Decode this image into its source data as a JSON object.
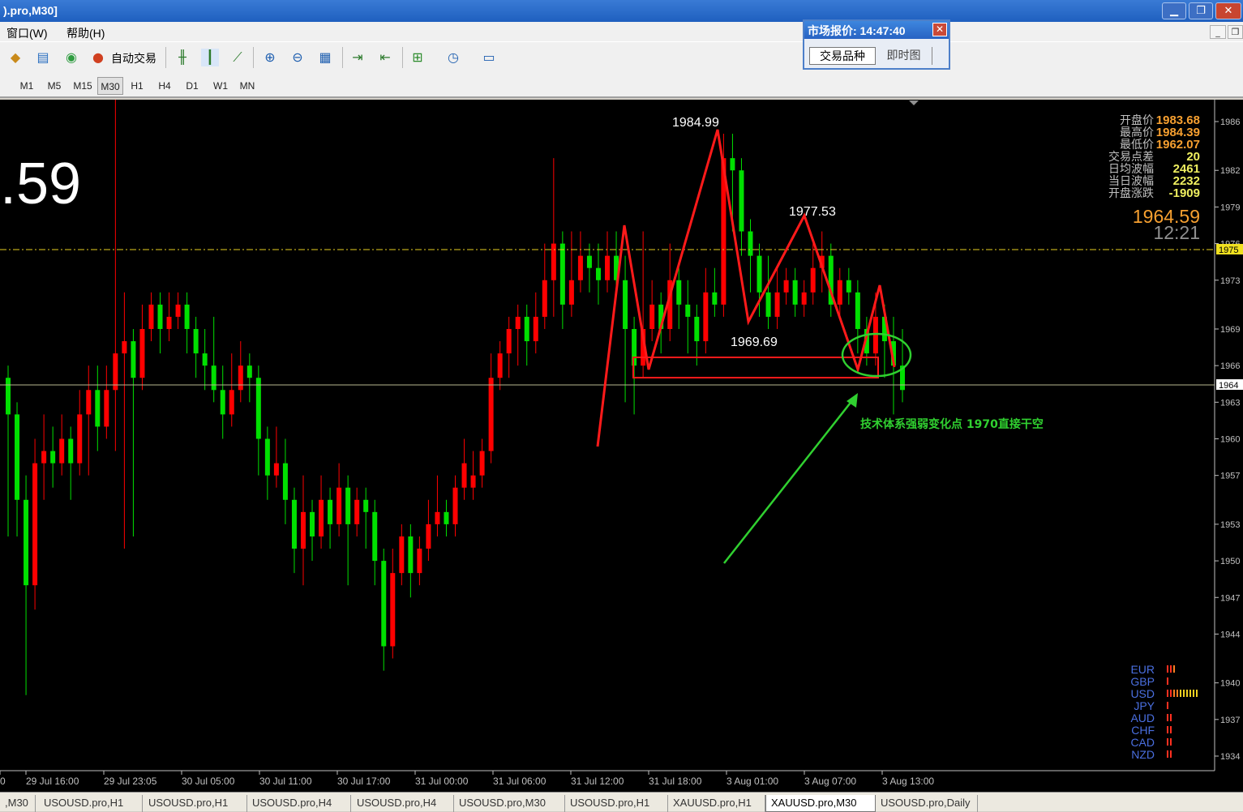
{
  "window": {
    "title": ").pro,M30]"
  },
  "menu": [
    "窗口(W)",
    "帮助(H)"
  ],
  "toolbar": {
    "auto_trade_label": "自动交易"
  },
  "timeframes": [
    "M1",
    "M5",
    "M15",
    "M30",
    "H1",
    "H4",
    "D1",
    "W1",
    "MN"
  ],
  "active_timeframe": "M30",
  "market_watch": {
    "title": "市场报价: 14:47:40",
    "tabs": [
      "交易品种",
      "即时图"
    ]
  },
  "chart": {
    "big_price_partial": ".59",
    "info_labels": [
      "开盘价",
      "最高价",
      "最低价",
      "交易点差",
      "日均波幅",
      "当日波幅",
      "开盘涨跌"
    ],
    "info_values": [
      "1983.68",
      "1984.39",
      "1962.07",
      "20",
      "2461",
      "2232",
      "-1909"
    ],
    "current_price": "1964.59",
    "countdown": "12:21",
    "price_axis": [
      "1986",
      "1982",
      "1979",
      "1976",
      "1973",
      "1969",
      "1966",
      "1963",
      "1960",
      "1957",
      "1953",
      "1950",
      "1947",
      "1944",
      "1940",
      "1937",
      "1934"
    ],
    "price_marker_1975": "1975",
    "price_marker_bid": "1964",
    "time_axis": [
      "0",
      "29 Jul 16:00",
      "29 Jul 23:05",
      "30 Jul 05:00",
      "30 Jul 11:00",
      "30 Jul 17:00",
      "31 Jul 00:00",
      "31 Jul 06:00",
      "31 Jul 12:00",
      "31 Jul 18:00",
      "3 Aug 01:00",
      "3 Aug 07:00",
      "3 Aug 13:00"
    ],
    "annotations": {
      "high": "1984.99",
      "second_high": "1977.53",
      "low": "1969.69",
      "comment": "技术体系强弱变化点 1970直接干空"
    },
    "currency_strength": [
      {
        "code": "EUR",
        "bars": 3
      },
      {
        "code": "GBP",
        "bars": 1
      },
      {
        "code": "USD",
        "bars": 10
      },
      {
        "code": "JPY",
        "bars": 1
      },
      {
        "code": "AUD",
        "bars": 2
      },
      {
        "code": "CHF",
        "bars": 2
      },
      {
        "code": "CAD",
        "bars": 2
      },
      {
        "code": "NZD",
        "bars": 2
      }
    ],
    "candles": [
      [
        1965,
        1962,
        1966,
        1952
      ],
      [
        1962,
        1955,
        1963,
        1952
      ],
      [
        1955,
        1948,
        1957,
        1939
      ],
      [
        1948,
        1958,
        1960,
        1946
      ],
      [
        1958,
        1959,
        1962,
        1955
      ],
      [
        1959,
        1958,
        1961,
        1956
      ],
      [
        1958,
        1960,
        1962,
        1957
      ],
      [
        1960,
        1958,
        1961,
        1955
      ],
      [
        1958,
        1962,
        1964,
        1957
      ],
      [
        1962,
        1964,
        1966,
        1957
      ],
      [
        1964,
        1961,
        1966,
        1959
      ],
      [
        1961,
        1964,
        1966,
        1960
      ],
      [
        1964,
        1967,
        1989,
        1959
      ],
      [
        1967,
        1968,
        1972,
        1951
      ],
      [
        1968,
        1965,
        1969,
        1952
      ],
      [
        1965,
        1969,
        1971,
        1964
      ],
      [
        1969,
        1971,
        1972,
        1968
      ],
      [
        1971,
        1969,
        1972,
        1967
      ],
      [
        1969,
        1970,
        1972,
        1968
      ],
      [
        1970,
        1971,
        1972,
        1969
      ],
      [
        1971,
        1969,
        1972,
        1967
      ],
      [
        1969,
        1967,
        1970,
        1965
      ],
      [
        1967,
        1966,
        1969,
        1964
      ],
      [
        1966,
        1964,
        1970,
        1963
      ],
      [
        1964,
        1962,
        1966,
        1960
      ],
      [
        1962,
        1964,
        1967,
        1961
      ],
      [
        1964,
        1966,
        1968,
        1963
      ],
      [
        1966,
        1965,
        1967,
        1963
      ],
      [
        1965,
        1960,
        1966,
        1957
      ],
      [
        1960,
        1957,
        1961,
        1955
      ],
      [
        1957,
        1958,
        1961,
        1956
      ],
      [
        1958,
        1955,
        1960,
        1953
      ],
      [
        1955,
        1951,
        1956,
        1949
      ],
      [
        1951,
        1954,
        1957,
        1948
      ],
      [
        1954,
        1952,
        1955,
        1950
      ],
      [
        1952,
        1955,
        1957,
        1951
      ],
      [
        1955,
        1953,
        1956,
        1951
      ],
      [
        1953,
        1956,
        1958,
        1952
      ],
      [
        1956,
        1953,
        1957,
        1948
      ],
      [
        1953,
        1955,
        1956,
        1952
      ],
      [
        1955,
        1954,
        1956,
        1951
      ],
      [
        1954,
        1950,
        1955,
        1948
      ],
      [
        1950,
        1943,
        1951,
        1941
      ],
      [
        1943,
        1949,
        1951,
        1942
      ],
      [
        1949,
        1952,
        1953,
        1948
      ],
      [
        1952,
        1949,
        1953,
        1947
      ],
      [
        1949,
        1951,
        1952,
        1948
      ],
      [
        1951,
        1953,
        1955,
        1950
      ],
      [
        1953,
        1954,
        1957,
        1952
      ],
      [
        1954,
        1953,
        1955,
        1952
      ],
      [
        1953,
        1956,
        1957,
        1952
      ],
      [
        1956,
        1958,
        1960,
        1955
      ],
      [
        1956,
        1957,
        1959,
        1955
      ],
      [
        1957,
        1959,
        1960,
        1956
      ],
      [
        1959,
        1965,
        1967,
        1958
      ],
      [
        1965,
        1967,
        1968,
        1964
      ],
      [
        1967,
        1969,
        1970,
        1965
      ],
      [
        1969,
        1970,
        1971,
        1966
      ],
      [
        1970,
        1968,
        1971,
        1966
      ],
      [
        1968,
        1970,
        1972,
        1967
      ],
      [
        1970,
        1973,
        1976,
        1969
      ],
      [
        1973,
        1976,
        1983,
        1970
      ],
      [
        1976,
        1971,
        1977,
        1969
      ],
      [
        1971,
        1973,
        1977,
        1970
      ],
      [
        1973,
        1975,
        1977,
        1972
      ],
      [
        1975,
        1974,
        1976,
        1972
      ],
      [
        1974,
        1973,
        1976,
        1971
      ],
      [
        1973,
        1975,
        1977,
        1972
      ],
      [
        1975,
        1973,
        1977,
        1972
      ],
      [
        1973,
        1969,
        1975,
        1963
      ],
      [
        1969,
        1966,
        1970,
        1962
      ],
      [
        1966,
        1969,
        1977,
        1965
      ],
      [
        1969,
        1971,
        1973,
        1968
      ],
      [
        1971,
        1969,
        1972,
        1967
      ],
      [
        1969,
        1973,
        1976,
        1968
      ],
      [
        1973,
        1971,
        1974,
        1969
      ],
      [
        1971,
        1970,
        1973,
        1967
      ],
      [
        1970,
        1968,
        1971,
        1966
      ],
      [
        1968,
        1972,
        1974,
        1967
      ],
      [
        1972,
        1971,
        1974,
        1970
      ],
      [
        1971,
        1983,
        1985,
        1970
      ],
      [
        1983,
        1982,
        1985,
        1977
      ],
      [
        1982,
        1977,
        1983,
        1975
      ],
      [
        1977,
        1975,
        1978,
        1972
      ],
      [
        1975,
        1972,
        1976,
        1970
      ],
      [
        1972,
        1970,
        1975,
        1969
      ],
      [
        1970,
        1972,
        1974,
        1969
      ],
      [
        1972,
        1973,
        1974,
        1971
      ],
      [
        1973,
        1971,
        1974,
        1970
      ],
      [
        1971,
        1972,
        1973,
        1970
      ],
      [
        1972,
        1974,
        1976,
        1971
      ],
      [
        1974,
        1975,
        1977,
        1972
      ],
      [
        1975,
        1971,
        1976,
        1970
      ],
      [
        1971,
        1973,
        1974,
        1970
      ],
      [
        1973,
        1972,
        1974,
        1971
      ],
      [
        1972,
        1969,
        1973,
        1967
      ],
      [
        1969,
        1967,
        1970,
        1966
      ],
      [
        1967,
        1970,
        1972,
        1966
      ],
      [
        1970,
        1968,
        1971,
        1965
      ],
      [
        1968,
        1966,
        1970,
        1962
      ],
      [
        1966,
        1964,
        1969,
        1963
      ]
    ]
  },
  "symbol_tabs": [
    ",M30",
    "USOUSD.pro,H1",
    "USOUSD.pro,H1",
    "USOUSD.pro,H4",
    "USOUSD.pro,H4",
    "USOUSD.pro,M30",
    "USOUSD.pro,H1",
    "XAUUSD.pro,H1",
    "XAUUSD.pro,M30",
    "USOUSD.pro,Daily"
  ],
  "active_symbol_tab": "XAUUSD.pro,M30",
  "colors": {
    "bull": "#ff0000",
    "bear": "#00e000",
    "background": "#000000",
    "grid_text": "#c0c0c0",
    "orange": "#f7a030",
    "annotation_red": "#ff1a1a",
    "annotation_green": "#30d030"
  }
}
